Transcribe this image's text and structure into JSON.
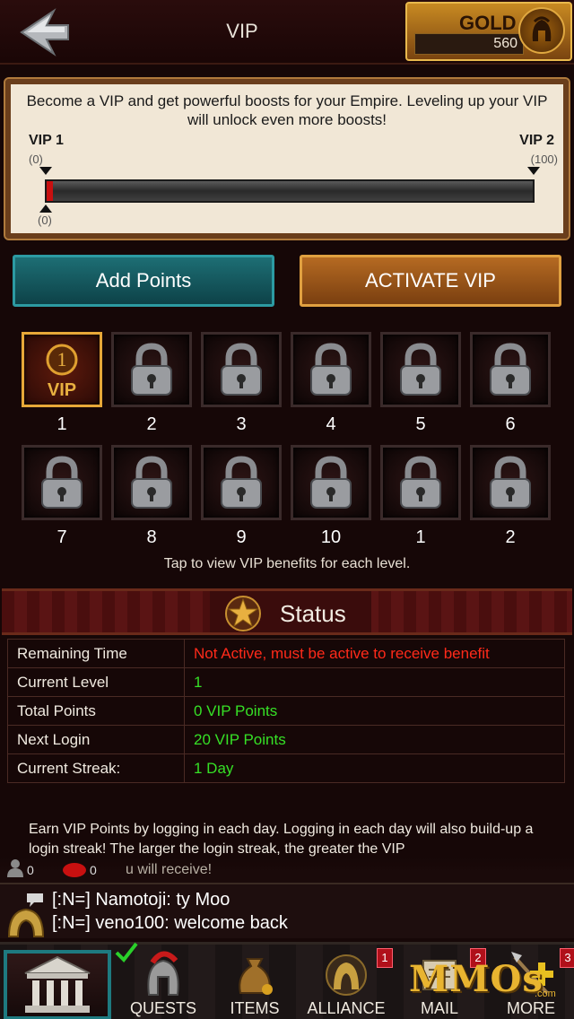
{
  "header": {
    "title": "VIP",
    "gold_label": "GOLD",
    "gold_value": "560"
  },
  "info": {
    "description": "Become a VIP and get powerful boosts for your Empire. Leveling up your VIP will unlock even more boosts!",
    "start_level": "VIP 1",
    "start_points": "(0)",
    "end_level": "VIP 2",
    "end_points": "(100)",
    "current_points": "(0)",
    "progress_fraction": 0
  },
  "buttons": {
    "add_points": "Add Points",
    "activate_vip": "ACTIVATE VIP"
  },
  "vip_levels": [
    {
      "label": "1",
      "active": true,
      "icon": "vip-badge-icon",
      "badge_text": "VIP"
    },
    {
      "label": "2",
      "active": false,
      "icon": "lock-icon"
    },
    {
      "label": "3",
      "active": false,
      "icon": "lock-icon"
    },
    {
      "label": "4",
      "active": false,
      "icon": "lock-icon"
    },
    {
      "label": "5",
      "active": false,
      "icon": "lock-icon"
    },
    {
      "label": "6",
      "active": false,
      "icon": "lock-icon"
    },
    {
      "label": "7",
      "active": false,
      "icon": "lock-icon"
    },
    {
      "label": "8",
      "active": false,
      "icon": "lock-icon"
    },
    {
      "label": "9",
      "active": false,
      "icon": "lock-icon"
    },
    {
      "label": "10",
      "active": false,
      "icon": "lock-icon"
    },
    {
      "label": "1",
      "active": false,
      "icon": "lock-icon"
    },
    {
      "label": "2",
      "active": false,
      "icon": "lock-icon"
    }
  ],
  "grid_hint": "Tap to view VIP benefits for each level.",
  "status": {
    "title": "Status",
    "rows": [
      {
        "key": "Remaining Time",
        "value": "Not Active, must be active to receive benefit",
        "color": "#ff2a1a"
      },
      {
        "key": "Current Level",
        "value": "1",
        "color": "#36e026"
      },
      {
        "key": "Total Points",
        "value": "0  VIP Points",
        "color": "#36e026"
      },
      {
        "key": "Next Login",
        "value": "20  VIP Points",
        "color": "#36e026"
      },
      {
        "key": "Current Streak:",
        "value": "1 Day",
        "color": "#36e026"
      }
    ]
  },
  "earn_text": "Earn VIP Points by logging in each day. Logging in each day will also build-up a login streak! The larger the login streak, the greater the VIP",
  "chat": {
    "online_count": "0",
    "alert_count": "0",
    "partial_text": "u will receive!",
    "lines": [
      "[:N=] Namotoji: ty Moo",
      "[:N=] veno100: welcome back"
    ]
  },
  "nav": {
    "quests": "QUESTS",
    "items": "ITEMS",
    "alliance": "ALLIANCE",
    "alliance_badge": "1",
    "mail": "MAIL",
    "mail_badge": "2",
    "more": "MORE",
    "more_badge": "3"
  },
  "watermark": {
    "text": "MMOs",
    "suffix": ".com"
  },
  "colors": {
    "accent_teal": "#1d6e74",
    "accent_orange": "#b56a22",
    "status_green": "#36e026",
    "status_red": "#ff2a1a"
  }
}
